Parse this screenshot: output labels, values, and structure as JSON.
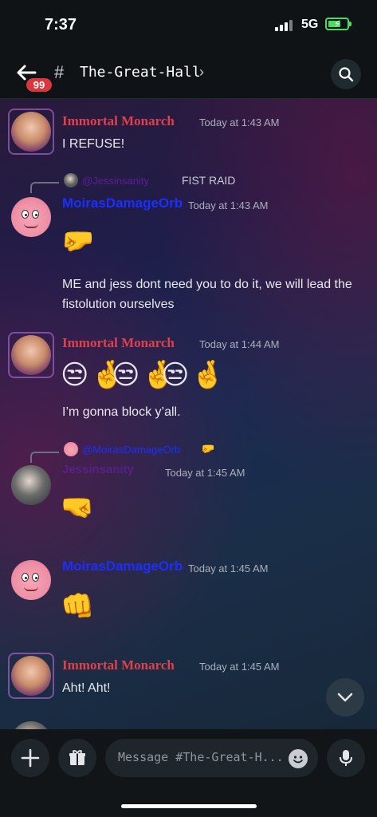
{
  "status": {
    "time": "7:37",
    "network": "5G"
  },
  "header": {
    "badge": "99",
    "channel_name": "The-Great-Hall",
    "chevron": "›",
    "hash": "#"
  },
  "messages": [
    {
      "user": "Immortal Monarch",
      "time": "Today at 1:43 AM",
      "text": "I REFUSE!"
    },
    {
      "reply_to_user": "@Jessinsanity",
      "reply_to_text": "FIST RAID",
      "user": "MoirasDamageOrb",
      "time": "Today at 1:43 AM",
      "emoji": "🤛",
      "text": "ME and jess dont need you to do it, we will lead the fistolution ourselves"
    },
    {
      "user": "Immortal Monarch",
      "time": "Today at 1:44 AM",
      "emoji": "😒🤞",
      "text": "I’m gonna block y’all."
    },
    {
      "reply_to_user": "@MoirasDamageOrb",
      "reply_to_text": "🤛",
      "user": "Jessinsanity",
      "time": "Today at 1:45 AM",
      "emoji": "🤜"
    },
    {
      "user": "MoirasDamageOrb",
      "time": "Today at 1:45 AM",
      "emoji": "👊"
    },
    {
      "user": "Immortal Monarch",
      "time": "Today at 1:45 AM",
      "text": "Aht! Aht!"
    }
  ],
  "composer": {
    "placeholder": "Message #The-Great-H..."
  },
  "icons": [
    "back-arrow-icon",
    "hash-icon",
    "search-icon",
    "chevron-down-icon",
    "plus-icon",
    "gift-icon",
    "emoji-icon",
    "microphone-icon"
  ],
  "colors": {
    "monarch": "#e0404a",
    "orb": "#1a2fff",
    "jess": "#6a1fb0",
    "badge": "#d9363e"
  }
}
